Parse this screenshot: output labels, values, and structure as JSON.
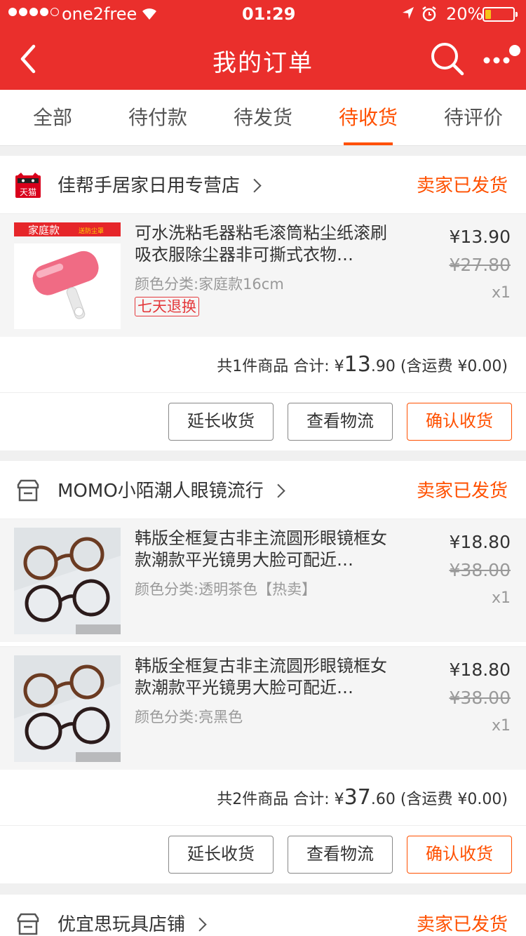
{
  "status_bar": {
    "carrier": "one2free",
    "time": "01:29",
    "battery": "20%"
  },
  "header": {
    "title": "我的订单"
  },
  "tabs": [
    {
      "label": "全部"
    },
    {
      "label": "待付款"
    },
    {
      "label": "待发货"
    },
    {
      "label": "待收货"
    },
    {
      "label": "待评价"
    }
  ],
  "actions": {
    "extend": "延长收货",
    "track": "查看物流",
    "confirm": "确认收货"
  },
  "orders": [
    {
      "shop": "佳帮手居家日用专营店",
      "shop_badge": "天猫",
      "status": "卖家已发货",
      "items": [
        {
          "title": "可水洗粘毛器粘毛滚筒粘尘纸滚刷吸衣服除尘器非可撕式衣物…",
          "sku": "颜色分类:家庭款16cm",
          "tag": "七天退换",
          "price": "¥13.90",
          "original_price": "¥27.80",
          "qty": "x1",
          "thumb_label": "家庭款",
          "thumb_sub": "送防尘罩"
        }
      ],
      "summary_prefix": "共1件商品 合计: ¥",
      "total_big": "13",
      "total_small": ".90",
      "shipping": "(含运费 ¥0.00)"
    },
    {
      "shop": "MOMO小陌潮人眼镜流行",
      "status": "卖家已发货",
      "items": [
        {
          "title": "韩版全框复古非主流圆形眼镜框女款潮款平光镜男大脸可配近…",
          "sku": "颜色分类:透明茶色【热卖】",
          "price": "¥18.80",
          "original_price": "¥38.00",
          "qty": "x1"
        },
        {
          "title": "韩版全框复古非主流圆形眼镜框女款潮款平光镜男大脸可配近…",
          "sku": "颜色分类:亮黑色",
          "price": "¥18.80",
          "original_price": "¥38.00",
          "qty": "x1"
        }
      ],
      "summary_prefix": "共2件商品 合计: ¥",
      "total_big": "37",
      "total_small": ".60",
      "shipping": "(含运费 ¥0.00)"
    },
    {
      "shop": "优宜思玩具店铺",
      "status": "卖家已发货"
    }
  ],
  "icons": {
    "back": "chevron-left-icon",
    "search": "search-icon",
    "more": "more-icon",
    "store": "store-icon",
    "tmall": "tmall-icon"
  },
  "colors": {
    "header_bg": "#ea2f2c",
    "accent": "#ff5000"
  }
}
